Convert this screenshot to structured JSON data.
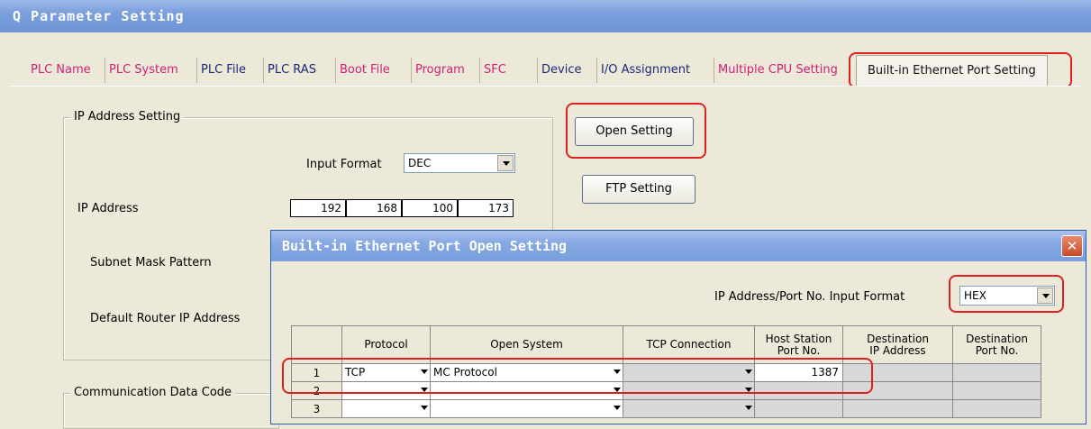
{
  "window": {
    "title": "Q Parameter Setting"
  },
  "tabs": [
    {
      "label": "PLC Name",
      "color": "pink"
    },
    {
      "label": "PLC System",
      "color": "pink"
    },
    {
      "label": "PLC File",
      "color": "dark"
    },
    {
      "label": "PLC RAS",
      "color": "dark"
    },
    {
      "label": "Boot File",
      "color": "pink"
    },
    {
      "label": "Program",
      "color": "pink"
    },
    {
      "label": "SFC",
      "color": "pink"
    },
    {
      "label": "Device",
      "color": "dark"
    },
    {
      "label": "I/O Assignment",
      "color": "dark"
    },
    {
      "label": "Multiple CPU Setting",
      "color": "pink"
    },
    {
      "label": "Built-in Ethernet Port Setting",
      "color": "active"
    }
  ],
  "ip_setting": {
    "group_label": "IP Address Setting",
    "input_format_label": "Input Format",
    "input_format_value": "DEC",
    "ip_address_label": "IP Address",
    "ip_octets": [
      "192",
      "168",
      "100",
      "173"
    ],
    "subnet_label": "Subnet Mask Pattern",
    "router_label": "Default Router IP Address"
  },
  "buttons": {
    "open_setting": "Open Setting",
    "ftp_setting": "FTP Setting"
  },
  "comm_group_label": "Communication Data Code",
  "dialog": {
    "title": "Built-in Ethernet Port Open Setting",
    "close_glyph": "✕",
    "format_label": "IP Address/Port No. Input Format",
    "format_value": "HEX",
    "headers": {
      "protocol": "Protocol",
      "open_system": "Open System",
      "tcp_connection": "TCP Connection",
      "host_port_1": "Host Station",
      "host_port_2": "Port No.",
      "dest_ip_1": "Destination",
      "dest_ip_2": "IP Address",
      "dest_port_1": "Destination",
      "dest_port_2": "Port No."
    },
    "rows": [
      {
        "num": "1",
        "protocol": "TCP",
        "open_system": "MC Protocol",
        "tcp_connection": "",
        "host_port": "1387"
      },
      {
        "num": "2",
        "protocol": "",
        "open_system": "",
        "tcp_connection": "",
        "host_port": ""
      },
      {
        "num": "3",
        "protocol": "",
        "open_system": "",
        "tcp_connection": "",
        "host_port": ""
      }
    ]
  },
  "colors": {
    "highlight": "#e02020",
    "title_blue": "#7a9fdc",
    "tab_pink": "#d0207a"
  }
}
